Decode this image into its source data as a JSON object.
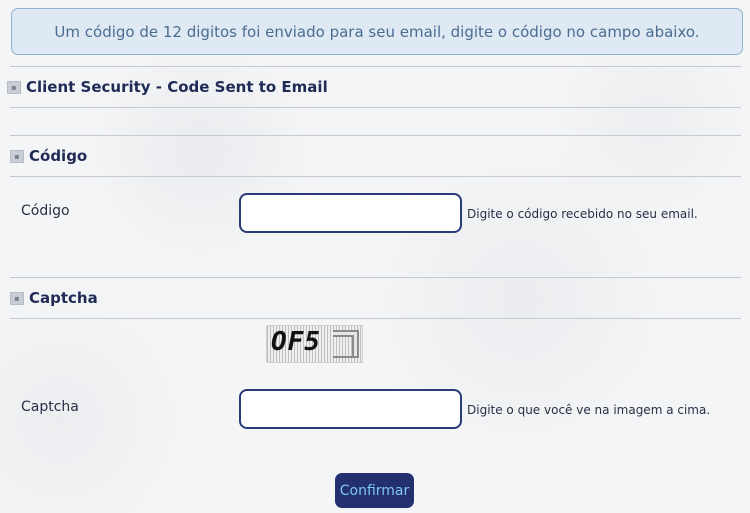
{
  "notice": "Um código de 12 digitos foi enviado para seu email, digite o código no campo abaixo.",
  "page_title": "Client Security - Code Sent to Email",
  "codigo_section": {
    "title": "Código",
    "label": "Código",
    "value": "",
    "hint": "Digite o código recebido no seu email."
  },
  "captcha_section": {
    "title": "Captcha",
    "image_text": "OF5",
    "label": "Captcha",
    "value": "",
    "hint": "Digite o que você ve na imagem a cima."
  },
  "confirm_label": "Confirmar",
  "colors": {
    "notice_bg": "#dfe9f3",
    "notice_text": "#4a6d91",
    "heading": "#1f2a55",
    "input_border": "#2b3a78",
    "button_bg": "#232f6e",
    "button_text": "#7ec8f2"
  },
  "icons": [
    "section-icon"
  ]
}
